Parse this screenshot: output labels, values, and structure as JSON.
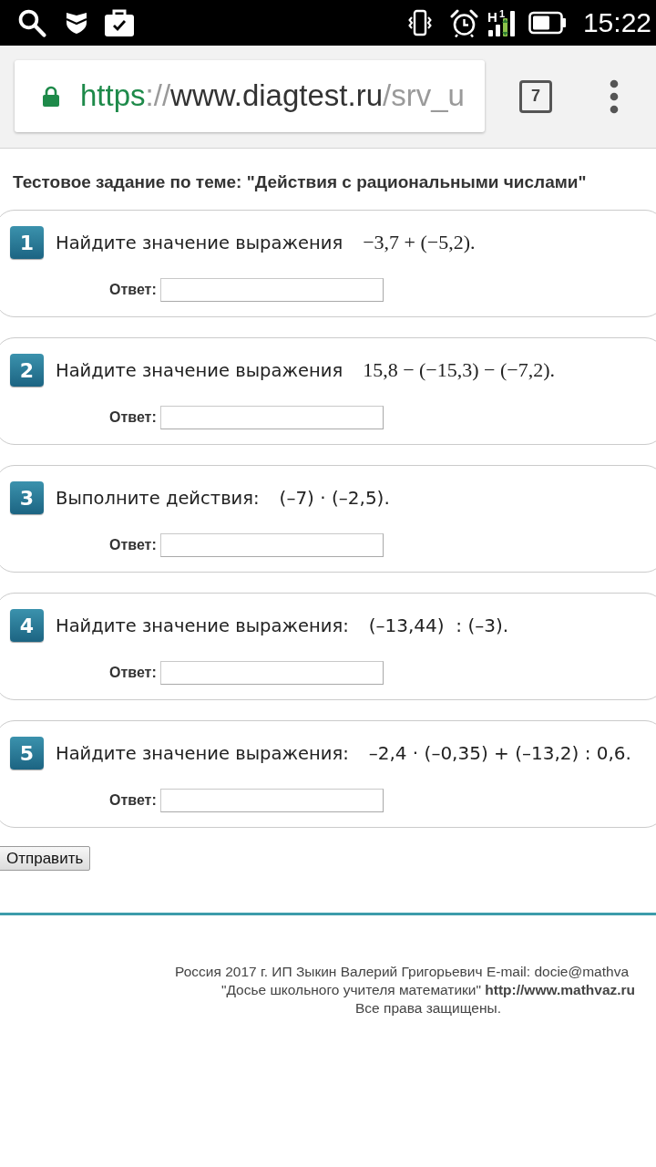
{
  "status_bar": {
    "network_type": "H",
    "sim_slot": "1",
    "time": "15:22"
  },
  "browser": {
    "url": {
      "scheme": "https",
      "separator": "://",
      "host": "www.diagtest.ru",
      "path": "/srv_u"
    },
    "tab_count": "7"
  },
  "page": {
    "title": "Тестовое задание по теме: \"Действия с рациональными числами\"",
    "questions": [
      {
        "number": "1",
        "prompt": "Найдите значение выражения",
        "kind": "formula",
        "expression": "−3,7 + (−5,2).",
        "answer_label": "Ответ:"
      },
      {
        "number": "2",
        "prompt": "Найдите значение выражения",
        "kind": "formula",
        "expression": "15,8 − (−15,3) − (−7,2).",
        "answer_label": "Ответ:"
      },
      {
        "number": "3",
        "prompt": "Выполните действия:",
        "kind": "plain",
        "expression": "(–7) · (–2,5).",
        "answer_label": "Ответ:"
      },
      {
        "number": "4",
        "prompt": "Найдите значение выражения:",
        "kind": "plain",
        "expression": "(–13,44)  : (–3).",
        "answer_label": "Ответ:"
      },
      {
        "number": "5",
        "prompt": "Найдите значение выражения:",
        "kind": "plain",
        "expression": "–2,4 · (–0,35) + (–13,2) : 0,6.",
        "answer_label": "Ответ:"
      }
    ],
    "submit_button": "Отправить"
  },
  "footer": {
    "lines": [
      "Россия 2017 г. ИП Зыкин Валерий Григорьевич E-mail: docie@mathva",
      "\"Досье школьного учителя математики\" **http://www.mathvaz.ru**",
      "Все права защищены."
    ]
  }
}
